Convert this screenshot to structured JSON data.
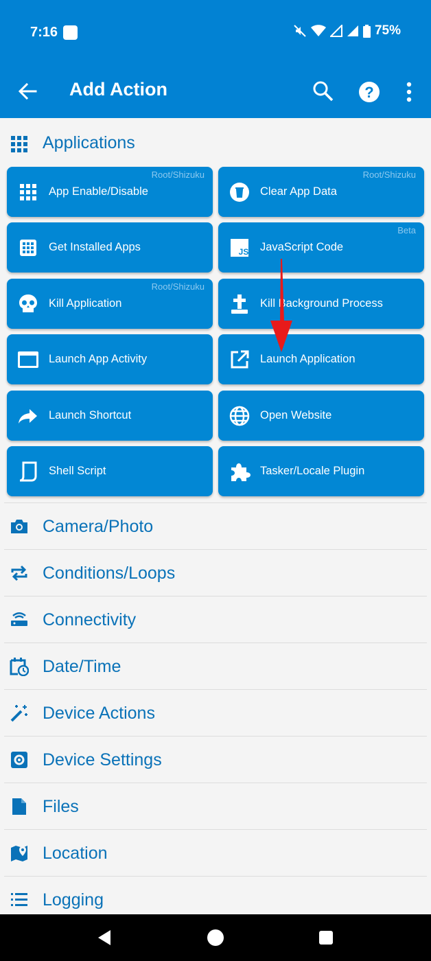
{
  "status": {
    "time": "7:16",
    "battery": "75%"
  },
  "appbar": {
    "title": "Add Action"
  },
  "section": {
    "label": "Applications"
  },
  "tiles": [
    {
      "label": "App Enable/Disable",
      "tag": "Root/Shizuku",
      "icon": "grid-icon"
    },
    {
      "label": "Clear App Data",
      "tag": "Root/Shizuku",
      "icon": "trash-icon"
    },
    {
      "label": "Get Installed Apps",
      "tag": "",
      "icon": "apps-icon"
    },
    {
      "label": "JavaScript Code",
      "tag": "Beta",
      "icon": "js-icon"
    },
    {
      "label": "Kill Application",
      "tag": "Root/Shizuku",
      "icon": "skull-icon"
    },
    {
      "label": "Kill Background Process",
      "tag": "",
      "icon": "grave-icon"
    },
    {
      "label": "Launch App Activity",
      "tag": "",
      "icon": "window-icon"
    },
    {
      "label": "Launch Application",
      "tag": "",
      "icon": "open-external-icon"
    },
    {
      "label": "Launch Shortcut",
      "tag": "",
      "icon": "share-arrow-icon"
    },
    {
      "label": "Open Website",
      "tag": "",
      "icon": "globe-icon"
    },
    {
      "label": "Shell Script",
      "tag": "",
      "icon": "script-icon"
    },
    {
      "label": "Tasker/Locale Plugin",
      "tag": "",
      "icon": "puzzle-icon"
    }
  ],
  "categories": [
    {
      "label": "Camera/Photo",
      "icon": "camera-icon"
    },
    {
      "label": "Conditions/Loops",
      "icon": "repeat-icon"
    },
    {
      "label": "Connectivity",
      "icon": "router-icon"
    },
    {
      "label": "Date/Time",
      "icon": "calendar-clock-icon"
    },
    {
      "label": "Device Actions",
      "icon": "magic-wand-icon"
    },
    {
      "label": "Device Settings",
      "icon": "settings-icon"
    },
    {
      "label": "Files",
      "icon": "file-icon"
    },
    {
      "label": "Location",
      "icon": "map-pin-icon"
    },
    {
      "label": "Logging",
      "icon": "list-icon"
    }
  ],
  "colors": {
    "primary": "#0282d3",
    "tile": "#0287d4",
    "accent_text": "#0a72b8",
    "arrow": "#e81a1a"
  }
}
